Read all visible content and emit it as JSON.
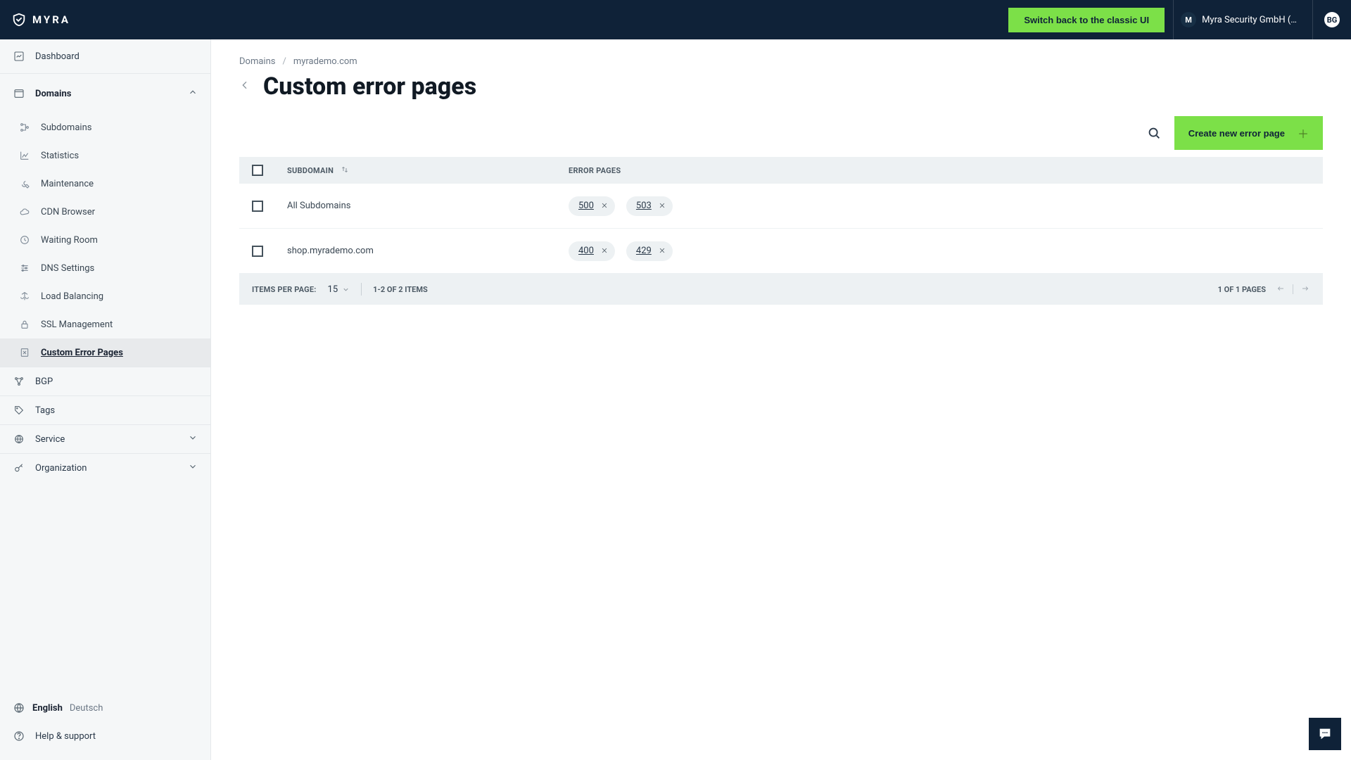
{
  "header": {
    "brand": "MYRA",
    "classic_button": "Switch back to the classic UI",
    "org_initial": "M",
    "org_name": "Myra Security GmbH (…",
    "user_initials": "BG"
  },
  "sidebar": {
    "dashboard": "Dashboard",
    "domains": "Domains",
    "subdomains": "Subdomains",
    "statistics": "Statistics",
    "maintenance": "Maintenance",
    "cdn": "CDN Browser",
    "waiting": "Waiting Room",
    "dns": "DNS Settings",
    "lb": "Load Balancing",
    "ssl": "SSL Management",
    "cep": "Custom Error Pages",
    "bgp": "BGP",
    "tags": "Tags",
    "service": "Service",
    "organization": "Organization",
    "lang_en": "English",
    "lang_de": "Deutsch",
    "help": "Help & support"
  },
  "breadcrumb": {
    "root": "Domains",
    "current": "myrademo.com"
  },
  "page": {
    "title": "Custom error pages",
    "create_button": "Create new error page"
  },
  "table": {
    "head_sub": "SUBDOMAIN",
    "head_err": "ERROR PAGES",
    "rows": [
      {
        "sub": "All Subdomains",
        "chips": [
          "500",
          "503"
        ]
      },
      {
        "sub": "shop.myrademo.com",
        "chips": [
          "400",
          "429"
        ]
      }
    ],
    "foot": {
      "ipp_label": "ITEMS PER PAGE:",
      "ipp_value": "15",
      "range": "1-2 OF 2 ITEMS",
      "pages": "1 OF 1 PAGES"
    }
  }
}
